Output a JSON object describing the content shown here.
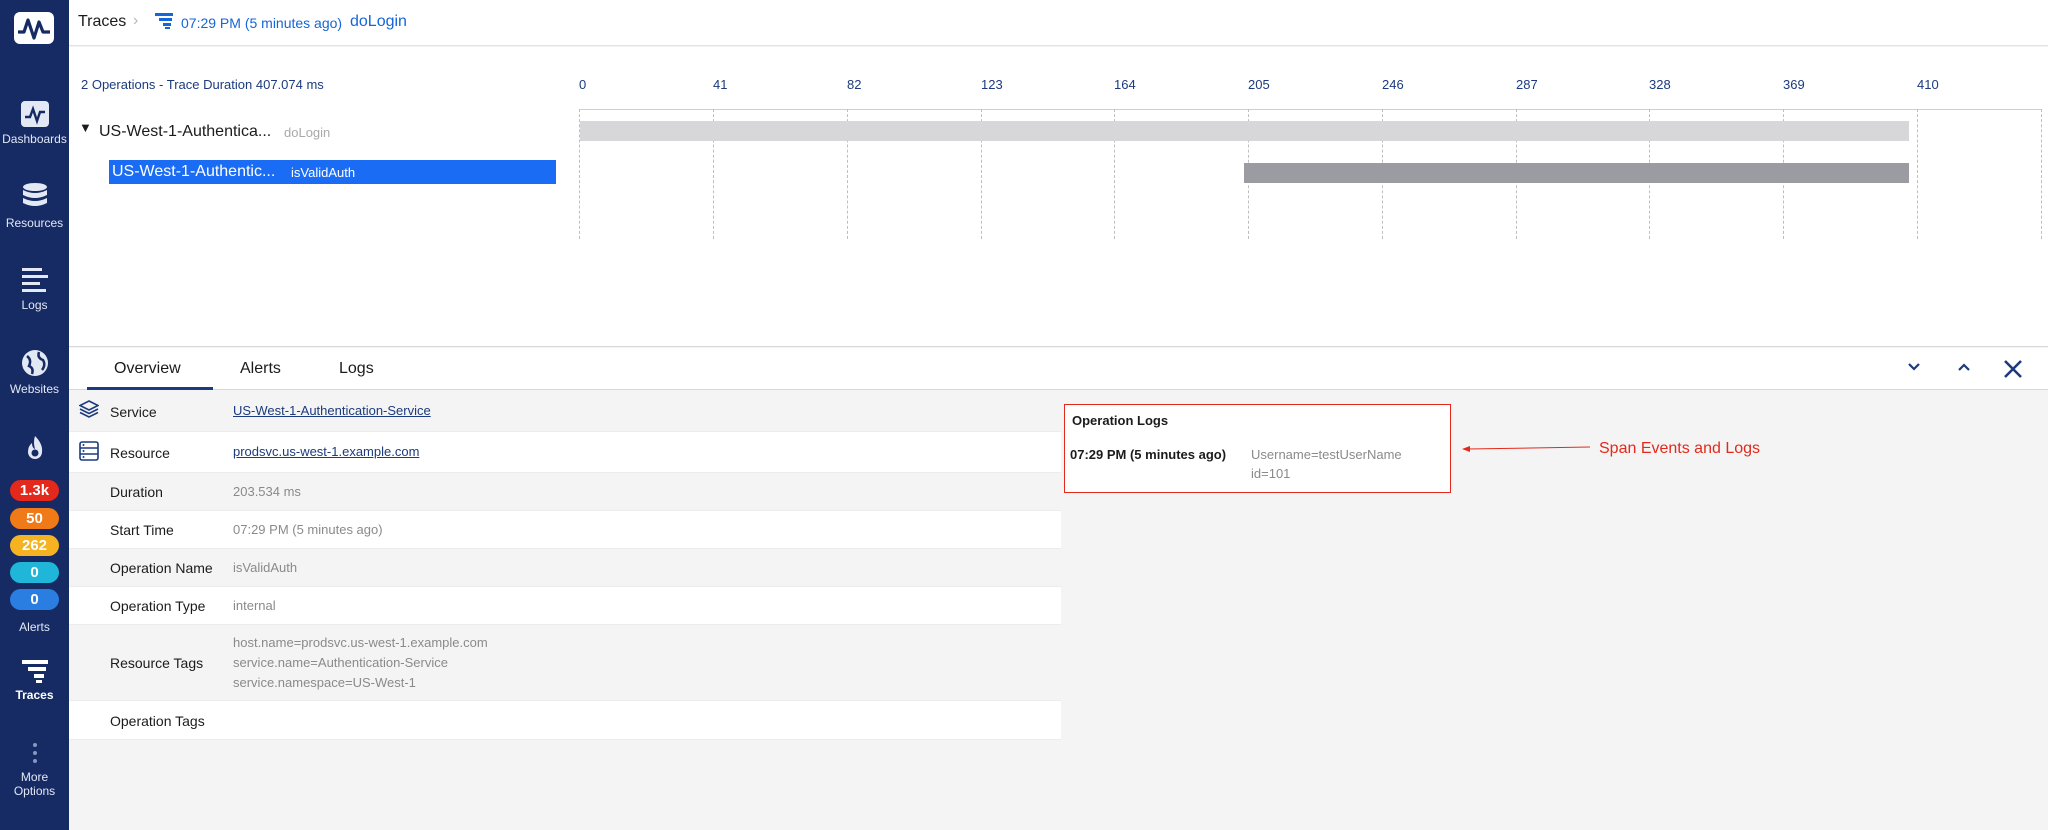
{
  "sidebar": {
    "items": [
      {
        "label": "Dashboards"
      },
      {
        "label": "Resources"
      },
      {
        "label": "Logs"
      },
      {
        "label": "Websites"
      },
      {
        "label": "Alerts"
      },
      {
        "label": "Traces"
      },
      {
        "label": "More Options"
      }
    ],
    "badges": [
      {
        "value": "1.3k",
        "color": "#e3291b"
      },
      {
        "value": "50",
        "color": "#f07a17"
      },
      {
        "value": "262",
        "color": "#f5b321"
      },
      {
        "value": "0",
        "color": "#1fb6d9"
      },
      {
        "value": "0",
        "color": "#2a7de1"
      }
    ]
  },
  "header": {
    "breadcrumb_root": "Traces",
    "trace_time": "07:29 PM  (5 minutes ago)",
    "operation": "doLogin"
  },
  "timeline": {
    "summary": "2 Operations - Trace Duration 407.074 ms",
    "ticks": [
      "0",
      "41",
      "82",
      "123",
      "164",
      "205",
      "246",
      "287",
      "328",
      "369",
      "410"
    ],
    "spans": [
      {
        "service": "US-West-1-Authentica...",
        "operation": "doLogin",
        "start_ms": 0,
        "end_ms": 407.074,
        "color": "#d7d7da"
      },
      {
        "service": "US-West-1-Authentic...",
        "operation": "isValidAuth",
        "start_ms": 203.54,
        "end_ms": 407.074,
        "color": "#9a9ca2"
      }
    ]
  },
  "tabs": [
    {
      "label": "Overview",
      "active": true
    },
    {
      "label": "Alerts",
      "active": false
    },
    {
      "label": "Logs",
      "active": false
    }
  ],
  "details": {
    "service": {
      "label": "Service",
      "value": "US-West-1-Authentication-Service"
    },
    "resource": {
      "label": "Resource",
      "value": "prodsvc.us-west-1.example.com"
    },
    "duration": {
      "label": "Duration",
      "value": "203.534 ms"
    },
    "start_time": {
      "label": "Start Time",
      "value": "07:29 PM  (5 minutes ago)"
    },
    "operation_name": {
      "label": "Operation Name",
      "value": "isValidAuth"
    },
    "operation_type": {
      "label": "Operation Type",
      "value": "internal"
    },
    "resource_tags": {
      "label": "Resource Tags",
      "values": [
        "host.name=prodsvc.us-west-1.example.com",
        "service.name=Authentication-Service",
        "service.namespace=US-West-1"
      ]
    },
    "operation_tags": {
      "label": "Operation Tags"
    }
  },
  "operation_logs": {
    "title": "Operation Logs",
    "time": "07:29 PM  (5 minutes ago)",
    "lines": [
      "Username=testUserName",
      "id=101"
    ]
  },
  "annotation": {
    "text": "Span Events and Logs",
    "color": "#e3291b"
  }
}
